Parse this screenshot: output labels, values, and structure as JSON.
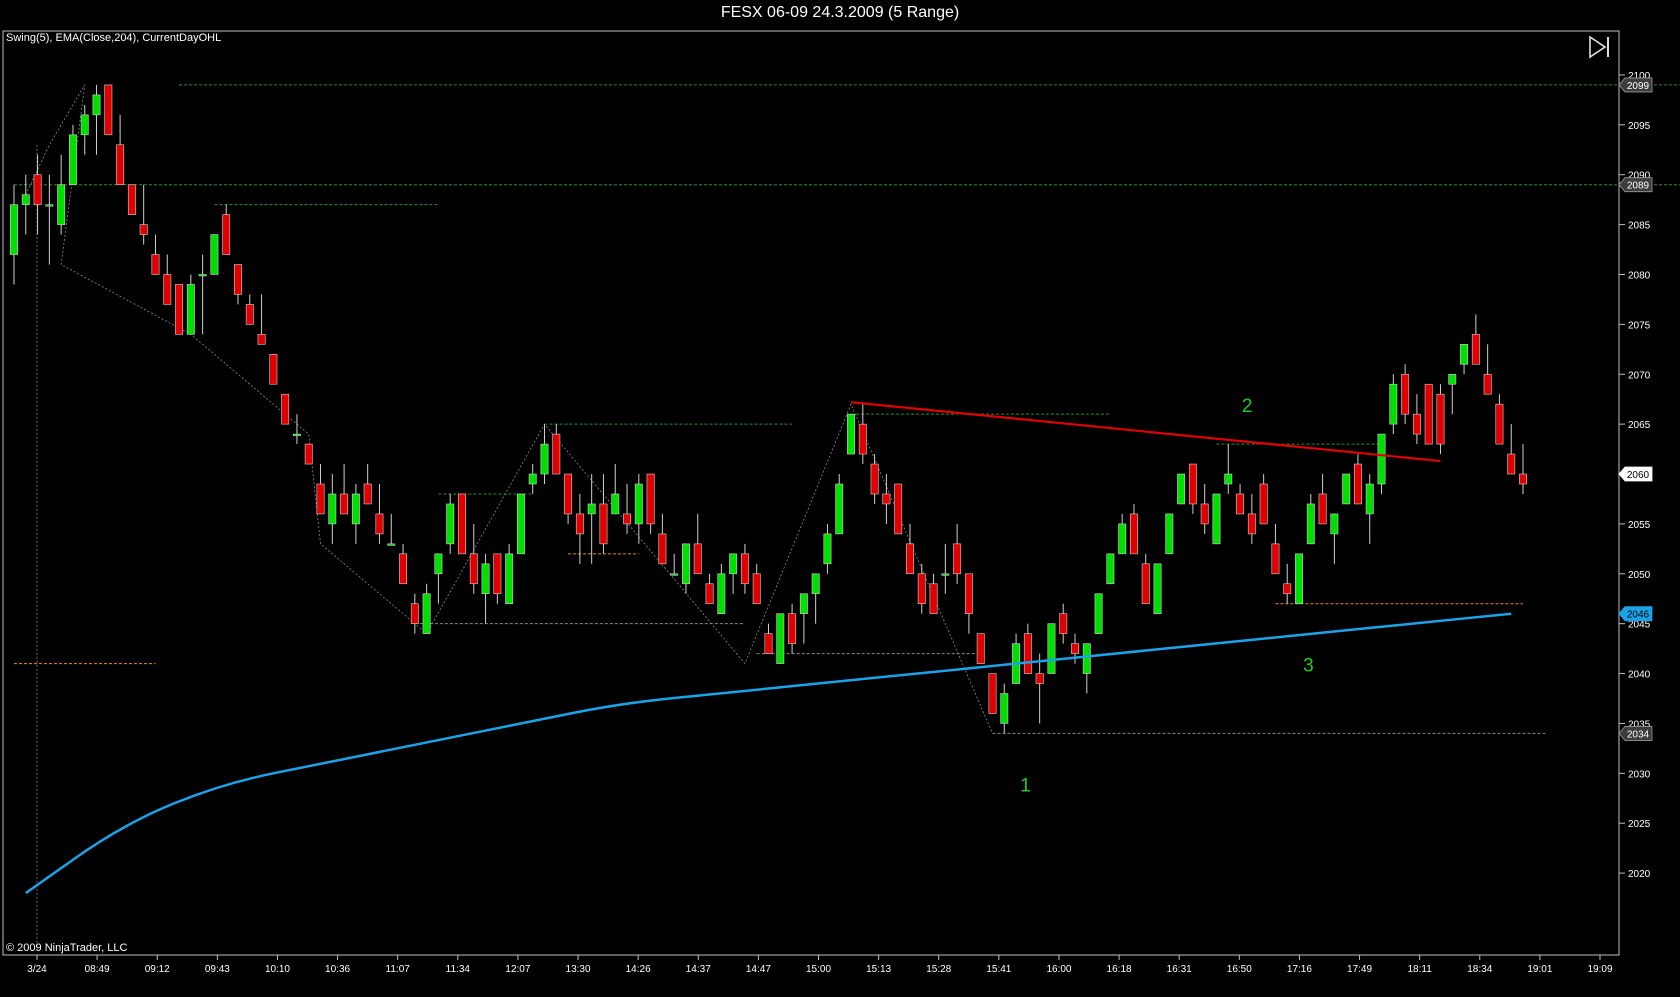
{
  "window": {
    "title": "FESX 06-09  24.3.2009 (5 Range)"
  },
  "chart_panel": {
    "indicators_label": "Swing(5), EMA(Close,204), CurrentDayOHL",
    "copyright": "© 2009 NinjaTrader, LLC",
    "play_icon": "skip-to-end-icon"
  },
  "colors": {
    "background": "#000000",
    "up_candle": "#00e000",
    "down_candle": "#e00000",
    "ema_line": "#1aa3e8",
    "trendline": "#e00000",
    "swing_high": "#2e8b2e",
    "swing_low": "#8a8a8a",
    "day_ohl": "#e8892a",
    "annotation": "#22cc22",
    "axis_line": "#c0c0c0"
  },
  "chart_data": {
    "type": "candlestick",
    "title": "FESX 06-09  24.3.2009 (5 Range)",
    "ylim": [
      2016,
      2102
    ],
    "y_ticks": [
      2020,
      2025,
      2030,
      2035,
      2040,
      2045,
      2050,
      2055,
      2060,
      2065,
      2070,
      2075,
      2080,
      2085,
      2090,
      2095,
      2100
    ],
    "x_ticks": [
      "3/24",
      "08:49",
      "09:12",
      "09:43",
      "10:10",
      "10:36",
      "11:07",
      "11:34",
      "12:07",
      "13:30",
      "14:26",
      "14:37",
      "14:47",
      "15:00",
      "15:13",
      "15:28",
      "15:41",
      "16:00",
      "16:18",
      "16:31",
      "16:50",
      "17:16",
      "17:49",
      "18:11",
      "18:34",
      "19:01",
      "19:09"
    ],
    "price_markers": [
      {
        "label": "2099",
        "value": 2099,
        "kind": "swing-high"
      },
      {
        "label": "2089",
        "value": 2089,
        "kind": "swing-high"
      },
      {
        "label": "2060",
        "value": 2060,
        "kind": "last"
      },
      {
        "label": "2046",
        "value": 2046,
        "kind": "ema"
      },
      {
        "label": "2034",
        "value": 2034,
        "kind": "low"
      }
    ],
    "candles": [
      {
        "o": 2082,
        "h": 2089,
        "l": 2079,
        "c": 2087
      },
      {
        "o": 2087,
        "h": 2090,
        "l": 2084,
        "c": 2088
      },
      {
        "o": 2090,
        "h": 2092,
        "l": 2084,
        "c": 2087
      },
      {
        "o": 2087,
        "h": 2090,
        "l": 2081,
        "c": 2087
      },
      {
        "o": 2085,
        "h": 2092,
        "l": 2084,
        "c": 2089
      },
      {
        "o": 2089,
        "h": 2095,
        "l": 2089,
        "c": 2094
      },
      {
        "o": 2094,
        "h": 2097,
        "l": 2092,
        "c": 2096
      },
      {
        "o": 2096,
        "h": 2099,
        "l": 2092,
        "c": 2098
      },
      {
        "o": 2099,
        "h": 2099,
        "l": 2094,
        "c": 2094
      },
      {
        "o": 2093,
        "h": 2096,
        "l": 2089,
        "c": 2089
      },
      {
        "o": 2089,
        "h": 2089,
        "l": 2086,
        "c": 2086
      },
      {
        "o": 2085,
        "h": 2089,
        "l": 2083,
        "c": 2084
      },
      {
        "o": 2082,
        "h": 2084,
        "l": 2080,
        "c": 2080
      },
      {
        "o": 2080,
        "h": 2082,
        "l": 2077,
        "c": 2077
      },
      {
        "o": 2079,
        "h": 2079,
        "l": 2075,
        "c": 2074
      },
      {
        "o": 2074,
        "h": 2080,
        "l": 2074,
        "c": 2079
      },
      {
        "o": 2080,
        "h": 2082,
        "l": 2074,
        "c": 2080
      },
      {
        "o": 2080,
        "h": 2084,
        "l": 2080,
        "c": 2084
      },
      {
        "o": 2086,
        "h": 2087,
        "l": 2082,
        "c": 2082
      },
      {
        "o": 2081,
        "h": 2081,
        "l": 2077,
        "c": 2078
      },
      {
        "o": 2077,
        "h": 2078,
        "l": 2075,
        "c": 2075
      },
      {
        "o": 2074,
        "h": 2078,
        "l": 2073,
        "c": 2073
      },
      {
        "o": 2072,
        "h": 2072,
        "l": 2069,
        "c": 2069
      },
      {
        "o": 2068,
        "h": 2068,
        "l": 2065,
        "c": 2065
      },
      {
        "o": 2064,
        "h": 2066,
        "l": 2063,
        "c": 2064
      },
      {
        "o": 2063,
        "h": 2063,
        "l": 2061,
        "c": 2061
      },
      {
        "o": 2059,
        "h": 2061,
        "l": 2056,
        "c": 2056
      },
      {
        "o": 2055,
        "h": 2060,
        "l": 2053,
        "c": 2058
      },
      {
        "o": 2058,
        "h": 2061,
        "l": 2056,
        "c": 2056
      },
      {
        "o": 2055,
        "h": 2059,
        "l": 2053,
        "c": 2058
      },
      {
        "o": 2059,
        "h": 2061,
        "l": 2057,
        "c": 2057
      },
      {
        "o": 2056,
        "h": 2059,
        "l": 2053,
        "c": 2054
      },
      {
        "o": 2053,
        "h": 2056,
        "l": 2053,
        "c": 2053
      },
      {
        "o": 2052,
        "h": 2053,
        "l": 2049,
        "c": 2049
      },
      {
        "o": 2047,
        "h": 2048,
        "l": 2044,
        "c": 2045
      },
      {
        "o": 2044,
        "h": 2049,
        "l": 2044,
        "c": 2048
      },
      {
        "o": 2050,
        "h": 2052,
        "l": 2047,
        "c": 2052
      },
      {
        "o": 2053,
        "h": 2058,
        "l": 2052,
        "c": 2057
      },
      {
        "o": 2058,
        "h": 2058,
        "l": 2052,
        "c": 2052
      },
      {
        "o": 2052,
        "h": 2055,
        "l": 2048,
        "c": 2049
      },
      {
        "o": 2048,
        "h": 2052,
        "l": 2045,
        "c": 2051
      },
      {
        "o": 2052,
        "h": 2052,
        "l": 2047,
        "c": 2048
      },
      {
        "o": 2047,
        "h": 2053,
        "l": 2047,
        "c": 2052
      },
      {
        "o": 2052,
        "h": 2058,
        "l": 2052,
        "c": 2058
      },
      {
        "o": 2059,
        "h": 2061,
        "l": 2058,
        "c": 2060
      },
      {
        "o": 2060,
        "h": 2065,
        "l": 2059,
        "c": 2063
      },
      {
        "o": 2064,
        "h": 2065,
        "l": 2060,
        "c": 2060
      },
      {
        "o": 2060,
        "h": 2060,
        "l": 2055,
        "c": 2056
      },
      {
        "o": 2056,
        "h": 2058,
        "l": 2051,
        "c": 2054
      },
      {
        "o": 2056,
        "h": 2060,
        "l": 2051,
        "c": 2057
      },
      {
        "o": 2057,
        "h": 2060,
        "l": 2052,
        "c": 2053
      },
      {
        "o": 2056,
        "h": 2061,
        "l": 2056,
        "c": 2058
      },
      {
        "o": 2056,
        "h": 2059,
        "l": 2054,
        "c": 2055
      },
      {
        "o": 2055,
        "h": 2060,
        "l": 2053,
        "c": 2059
      },
      {
        "o": 2060,
        "h": 2060,
        "l": 2054,
        "c": 2055
      },
      {
        "o": 2054,
        "h": 2056,
        "l": 2051,
        "c": 2051
      },
      {
        "o": 2050,
        "h": 2052,
        "l": 2050,
        "c": 2050
      },
      {
        "o": 2049,
        "h": 2053,
        "l": 2048,
        "c": 2053
      },
      {
        "o": 2053,
        "h": 2056,
        "l": 2050,
        "c": 2050
      },
      {
        "o": 2049,
        "h": 2050,
        "l": 2047,
        "c": 2047
      },
      {
        "o": 2046,
        "h": 2051,
        "l": 2046,
        "c": 2050
      },
      {
        "o": 2050,
        "h": 2052,
        "l": 2048,
        "c": 2052
      },
      {
        "o": 2052,
        "h": 2053,
        "l": 2048,
        "c": 2049
      },
      {
        "o": 2050,
        "h": 2051,
        "l": 2047,
        "c": 2047
      },
      {
        "o": 2044,
        "h": 2045,
        "l": 2042,
        "c": 2042
      },
      {
        "o": 2041,
        "h": 2046,
        "l": 2041,
        "c": 2046
      },
      {
        "o": 2046,
        "h": 2047,
        "l": 2042,
        "c": 2043
      },
      {
        "o": 2046,
        "h": 2048,
        "l": 2043,
        "c": 2048
      },
      {
        "o": 2048,
        "h": 2050,
        "l": 2045,
        "c": 2050
      },
      {
        "o": 2051,
        "h": 2055,
        "l": 2050,
        "c": 2054
      },
      {
        "o": 2054,
        "h": 2060,
        "l": 2054,
        "c": 2059
      },
      {
        "o": 2062,
        "h": 2066,
        "l": 2062,
        "c": 2066
      },
      {
        "o": 2065,
        "h": 2067,
        "l": 2061,
        "c": 2062
      },
      {
        "o": 2061,
        "h": 2062,
        "l": 2057,
        "c": 2058
      },
      {
        "o": 2058,
        "h": 2060,
        "l": 2055,
        "c": 2057
      },
      {
        "o": 2059,
        "h": 2059,
        "l": 2054,
        "c": 2054
      },
      {
        "o": 2053,
        "h": 2055,
        "l": 2050,
        "c": 2050
      },
      {
        "o": 2050,
        "h": 2051,
        "l": 2046,
        "c": 2047
      },
      {
        "o": 2049,
        "h": 2050,
        "l": 2046,
        "c": 2046
      },
      {
        "o": 2050,
        "h": 2053,
        "l": 2048,
        "c": 2050
      },
      {
        "o": 2053,
        "h": 2055,
        "l": 2049,
        "c": 2050
      },
      {
        "o": 2050,
        "h": 2050,
        "l": 2044,
        "c": 2046
      },
      {
        "o": 2044,
        "h": 2044,
        "l": 2041,
        "c": 2041
      },
      {
        "o": 2040,
        "h": 2040,
        "l": 2036,
        "c": 2036
      },
      {
        "o": 2035,
        "h": 2039,
        "l": 2034,
        "c": 2038
      },
      {
        "o": 2039,
        "h": 2044,
        "l": 2039,
        "c": 2043
      },
      {
        "o": 2044,
        "h": 2045,
        "l": 2040,
        "c": 2040
      },
      {
        "o": 2040,
        "h": 2042,
        "l": 2035,
        "c": 2039
      },
      {
        "o": 2040,
        "h": 2045,
        "l": 2040,
        "c": 2045
      },
      {
        "o": 2046,
        "h": 2047,
        "l": 2043,
        "c": 2044
      },
      {
        "o": 2043,
        "h": 2044,
        "l": 2041,
        "c": 2042
      },
      {
        "o": 2040,
        "h": 2043,
        "l": 2038,
        "c": 2043
      },
      {
        "o": 2044,
        "h": 2048,
        "l": 2044,
        "c": 2048
      },
      {
        "o": 2049,
        "h": 2052,
        "l": 2049,
        "c": 2052
      },
      {
        "o": 2052,
        "h": 2056,
        "l": 2052,
        "c": 2055
      },
      {
        "o": 2056,
        "h": 2057,
        "l": 2052,
        "c": 2052
      },
      {
        "o": 2051,
        "h": 2052,
        "l": 2047,
        "c": 2047
      },
      {
        "o": 2046,
        "h": 2051,
        "l": 2046,
        "c": 2051
      },
      {
        "o": 2052,
        "h": 2056,
        "l": 2052,
        "c": 2056
      },
      {
        "o": 2057,
        "h": 2060,
        "l": 2057,
        "c": 2060
      },
      {
        "o": 2061,
        "h": 2061,
        "l": 2056,
        "c": 2057
      },
      {
        "o": 2057,
        "h": 2059,
        "l": 2054,
        "c": 2055
      },
      {
        "o": 2053,
        "h": 2058,
        "l": 2053,
        "c": 2058
      },
      {
        "o": 2059,
        "h": 2063,
        "l": 2058,
        "c": 2060
      },
      {
        "o": 2058,
        "h": 2059,
        "l": 2056,
        "c": 2056
      },
      {
        "o": 2056,
        "h": 2058,
        "l": 2053,
        "c": 2054
      },
      {
        "o": 2059,
        "h": 2060,
        "l": 2055,
        "c": 2055
      },
      {
        "o": 2053,
        "h": 2055,
        "l": 2050,
        "c": 2050
      },
      {
        "o": 2049,
        "h": 2051,
        "l": 2047,
        "c": 2048
      },
      {
        "o": 2047,
        "h": 2052,
        "l": 2047,
        "c": 2052
      },
      {
        "o": 2053,
        "h": 2058,
        "l": 2053,
        "c": 2057
      },
      {
        "o": 2058,
        "h": 2060,
        "l": 2055,
        "c": 2055
      },
      {
        "o": 2054,
        "h": 2056,
        "l": 2051,
        "c": 2056
      },
      {
        "o": 2057,
        "h": 2060,
        "l": 2057,
        "c": 2060
      },
      {
        "o": 2061,
        "h": 2062,
        "l": 2057,
        "c": 2057
      },
      {
        "o": 2056,
        "h": 2060,
        "l": 2053,
        "c": 2059
      },
      {
        "o": 2059,
        "h": 2064,
        "l": 2058,
        "c": 2064
      },
      {
        "o": 2065,
        "h": 2070,
        "l": 2064,
        "c": 2069
      },
      {
        "o": 2070,
        "h": 2071,
        "l": 2065,
        "c": 2066
      },
      {
        "o": 2066,
        "h": 2068,
        "l": 2063,
        "c": 2064
      },
      {
        "o": 2069,
        "h": 2069,
        "l": 2063,
        "c": 2063
      },
      {
        "o": 2068,
        "h": 2069,
        "l": 2062,
        "c": 2063
      },
      {
        "o": 2069,
        "h": 2070,
        "l": 2066,
        "c": 2070
      },
      {
        "o": 2071,
        "h": 2073,
        "l": 2070,
        "c": 2073
      },
      {
        "o": 2074,
        "h": 2076,
        "l": 2071,
        "c": 2071
      },
      {
        "o": 2070,
        "h": 2073,
        "l": 2068,
        "c": 2068
      },
      {
        "o": 2067,
        "h": 2068,
        "l": 2063,
        "c": 2063
      },
      {
        "o": 2062,
        "h": 2065,
        "l": 2060,
        "c": 2060
      },
      {
        "o": 2060,
        "h": 2063,
        "l": 2058,
        "c": 2059
      }
    ],
    "ema": [
      [
        0,
        2018
      ],
      [
        30,
        2025
      ],
      [
        60,
        2029
      ],
      [
        90,
        2031
      ],
      [
        120,
        2033
      ],
      [
        150,
        2035
      ],
      [
        180,
        2037
      ],
      [
        210,
        2038
      ],
      [
        240,
        2039
      ],
      [
        270,
        2040
      ],
      [
        300,
        2041
      ],
      [
        330,
        2042
      ],
      [
        360,
        2043
      ],
      [
        390,
        2044
      ],
      [
        420,
        2045
      ],
      [
        450,
        2046
      ]
    ],
    "annotations": [
      {
        "label": "1",
        "value": 2029
      },
      {
        "label": "2",
        "value": 2067
      },
      {
        "label": "3",
        "value": 2041
      }
    ]
  }
}
